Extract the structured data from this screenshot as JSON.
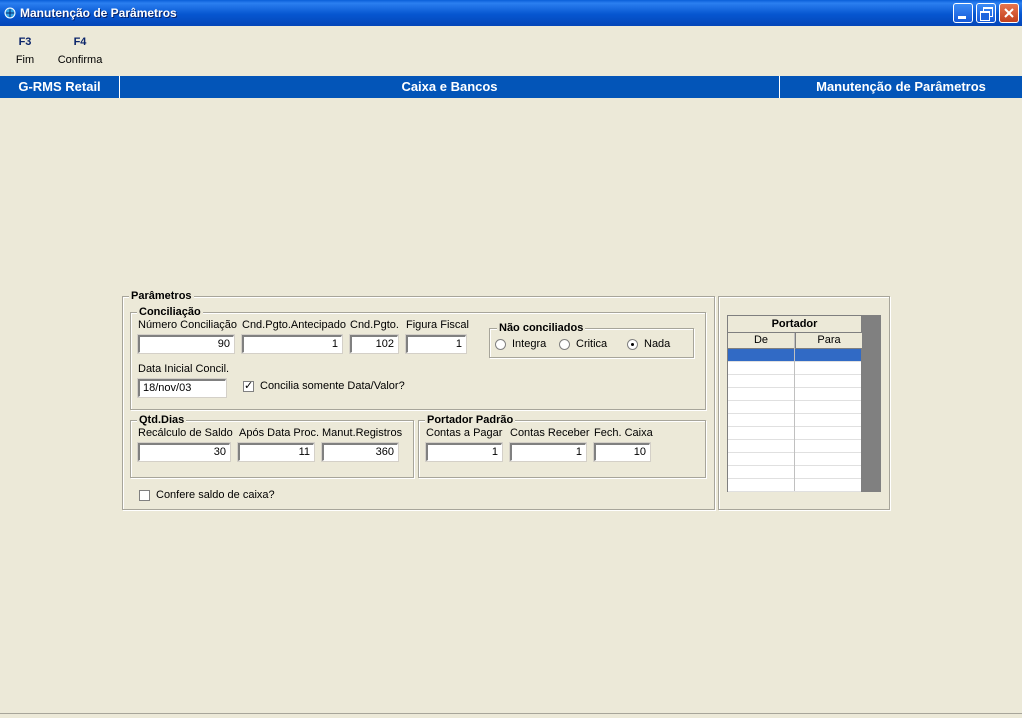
{
  "window": {
    "title": "Manutenção de Parâmetros"
  },
  "toolbar": {
    "keys": [
      {
        "key": "F3",
        "label": "Fim"
      },
      {
        "key": "F4",
        "label": "Confirma"
      }
    ]
  },
  "header": {
    "left": "G-RMS Retail",
    "center": "Caixa e Bancos",
    "right": "Manutenção de Parâmetros"
  },
  "parametros": {
    "title": "Parâmetros",
    "conciliacao": {
      "title": "Conciliação",
      "numero_label": "Número Conciliação",
      "numero_value": "90",
      "cnd_antecipado_label": "Cnd.Pgto.Antecipado",
      "cnd_antecipado_value": "1",
      "cnd_pgto_label": "Cnd.Pgto.",
      "cnd_pgto_value": "102",
      "figura_label": "Figura Fiscal",
      "figura_value": "1",
      "data_inicial_label": "Data Inicial Concil.",
      "data_inicial_value": "18/nov/03",
      "concilia_label": "Concilia somente Data/Valor?",
      "concilia_checked": true,
      "nao_conciliados": {
        "title": "Não conciliados",
        "options": [
          "Integra",
          "Critica",
          "Nada"
        ],
        "selected": "Nada"
      }
    },
    "qtd_dias": {
      "title": "Qtd.Dias",
      "recalculo_label": "Recálculo de Saldo",
      "recalculo_value": "30",
      "apos_label": "Após Data Proc.",
      "apos_value": "11",
      "manut_label": "Manut.Registros",
      "manut_value": "360"
    },
    "portador_padrao": {
      "title": "Portador Padrão",
      "pagar_label": "Contas a  Pagar",
      "pagar_value": "1",
      "receber_label": "Contas Receber",
      "receber_value": "1",
      "fech_label": "Fech. Caixa",
      "fech_value": "10"
    },
    "confere_label": "Confere saldo de caixa?",
    "confere_checked": false
  },
  "portador_grid": {
    "title": "Portador",
    "columns": [
      "De",
      "Para"
    ]
  },
  "colors": {
    "titlebar": "#0656D0",
    "header_band": "#0355B8",
    "window_bg": "#ECE9D8",
    "selection": "#316AC5"
  }
}
